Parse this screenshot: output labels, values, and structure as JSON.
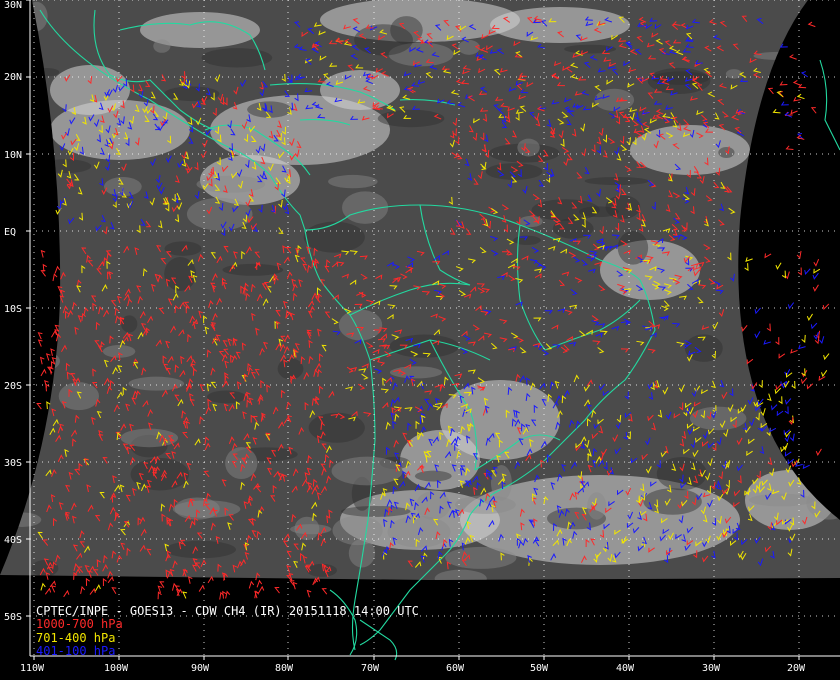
{
  "title": "CPTEC/INPE - GOES13 - CDW CH4 (IR) 20151118 14:00 UTC",
  "legend": [
    {
      "label": "1000-700 hPa",
      "color": "#ff2a2a"
    },
    {
      "label": "701-400 hPa",
      "color": "#f2e600"
    },
    {
      "label": "401-100 hPa",
      "color": "#1a1aff"
    }
  ],
  "lat_labels": [
    "30N",
    "20N",
    "10N",
    "EQ",
    "10S",
    "20S",
    "30S",
    "40S",
    "50S"
  ],
  "lon_labels": [
    "110W",
    "100W",
    "90W",
    "80W",
    "70W",
    "60W",
    "50W",
    "40W",
    "30W",
    "20W"
  ],
  "colors": {
    "coastline": "#23d9a0",
    "grid": "#ffffff",
    "background": "#000000"
  }
}
